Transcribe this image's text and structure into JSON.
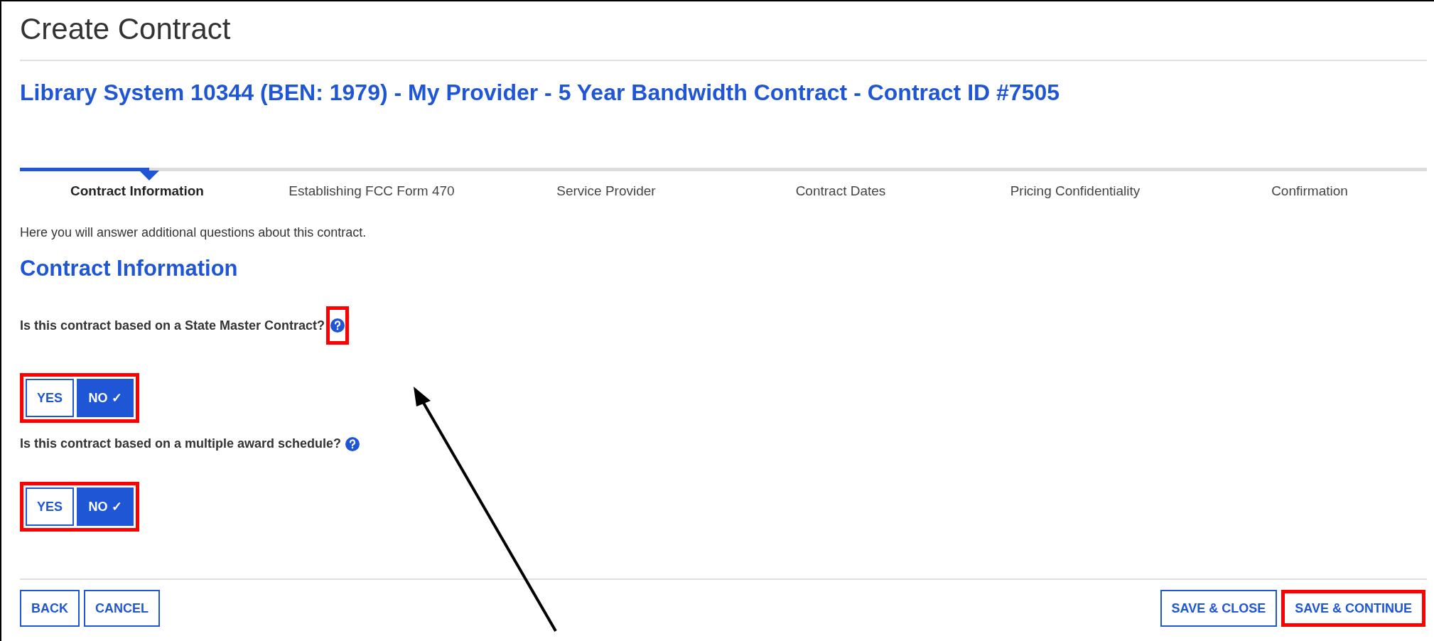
{
  "page_title": "Create Contract",
  "contract_title": "Library System 10344 (BEN: 1979) - My Provider - 5 Year Bandwidth Contract - Contract ID #7505",
  "steps": [
    {
      "label": "Contract Information",
      "selected": true
    },
    {
      "label": "Establishing FCC Form 470",
      "selected": false
    },
    {
      "label": "Service Provider",
      "selected": false
    },
    {
      "label": "Contract Dates",
      "selected": false
    },
    {
      "label": "Pricing Confidentiality",
      "selected": false
    },
    {
      "label": "Confirmation",
      "selected": false
    }
  ],
  "intro": "Here you will answer additional questions about this contract.",
  "section_title": "Contract Information",
  "check_glyph": "✓",
  "questions": [
    {
      "text": "Is this contract based on a State Master Contract?",
      "highlight_help": true,
      "highlight_answers": true,
      "options": [
        {
          "label": "YES",
          "selected": false
        },
        {
          "label": "NO",
          "selected": true
        }
      ]
    },
    {
      "text": "Is this contract based on a multiple award schedule?",
      "highlight_help": false,
      "highlight_answers": true,
      "options": [
        {
          "label": "YES",
          "selected": false
        },
        {
          "label": "NO",
          "selected": true
        }
      ]
    }
  ],
  "left_buttons": [
    "BACK",
    "CANCEL"
  ],
  "right_buttons": [
    {
      "label": "SAVE & CLOSE",
      "highlight": false
    },
    {
      "label": "SAVE & CONTINUE",
      "highlight": true
    }
  ]
}
